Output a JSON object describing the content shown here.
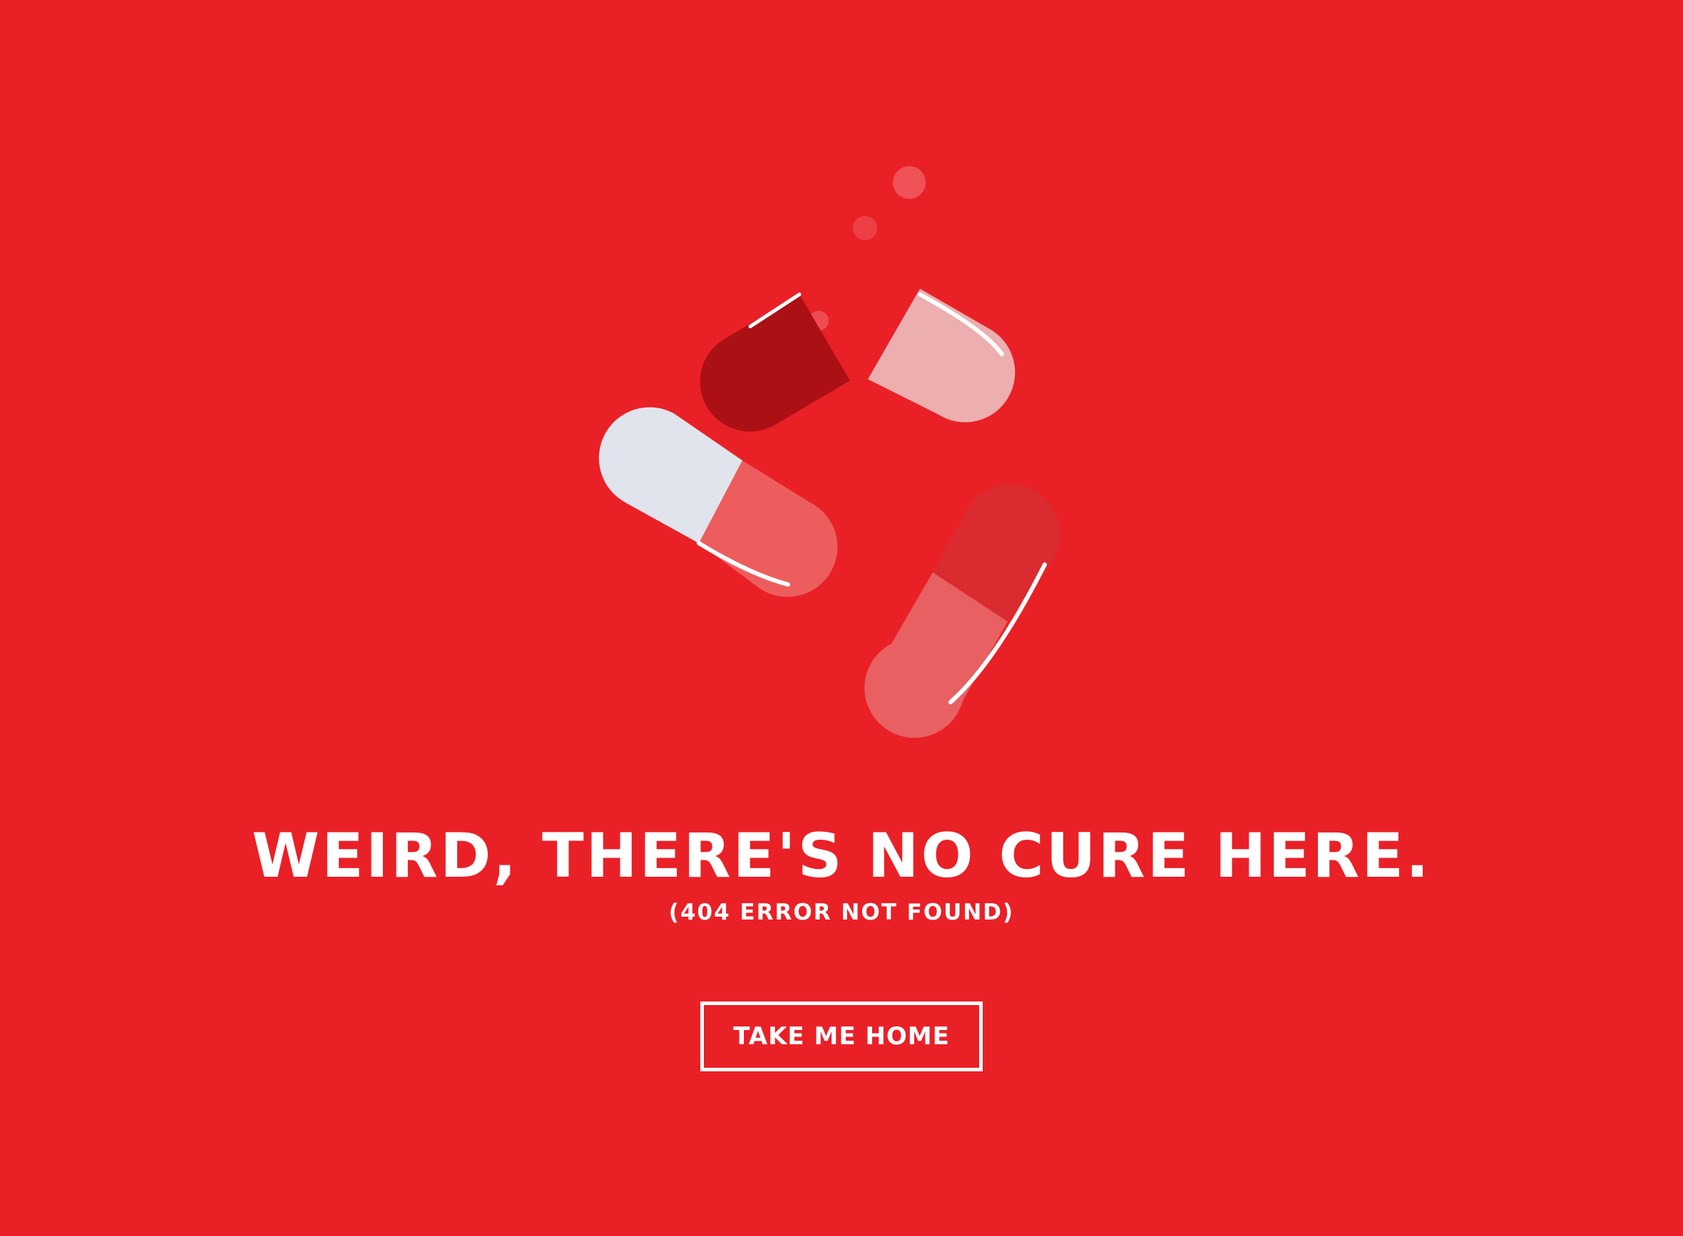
{
  "page": {
    "background_color": "#ea2027",
    "headline": "WEIRD, THERE'S NO CURE HERE.",
    "subheadline": "(404 ERROR NOT FOUND)",
    "home_button_label": "TAKE ME HOME"
  },
  "illustration": {
    "icons": [
      "broken-capsule-icon",
      "capsule-icon",
      "bubble-icon"
    ],
    "colors": {
      "dark_red": "#ab1015",
      "light_pink": "#ecaeae",
      "pale_gray": "#e1e4ec",
      "salmon": "#ee5d5e",
      "faded_red": "#d92b30",
      "faded_salmon": "#e86061"
    }
  }
}
